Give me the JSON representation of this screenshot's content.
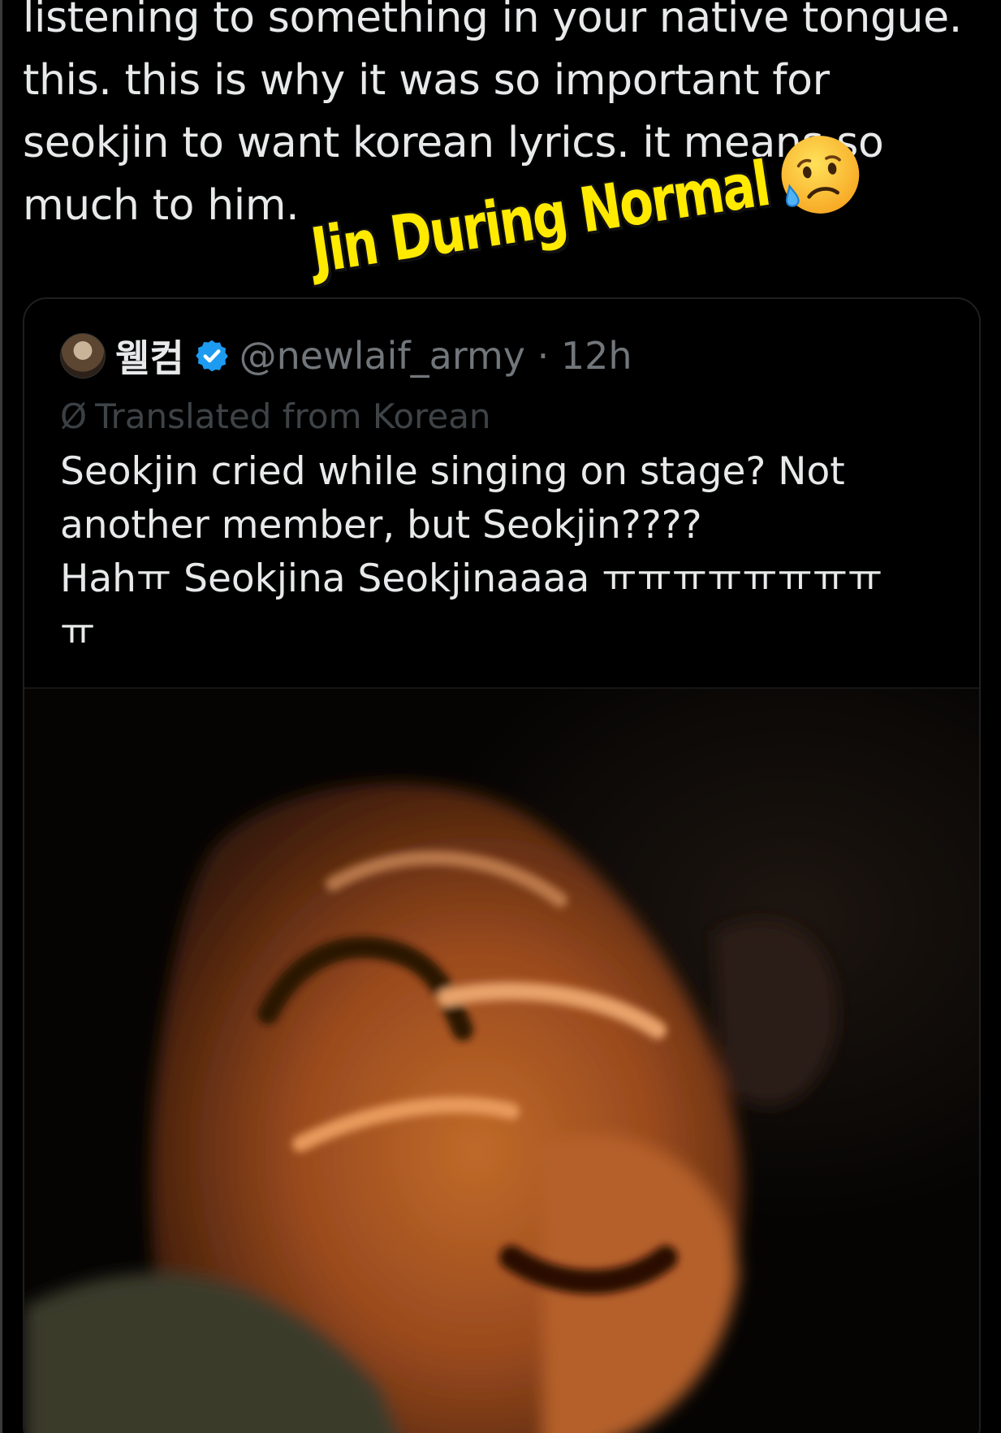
{
  "tweet": {
    "lines": [
      "listening to something in your native tongue.",
      "this. this is why it was so important for",
      "seokjin to want korean lyrics. it means so",
      "much to him."
    ]
  },
  "overlay": {
    "caption": "Jin During Normal",
    "emoji_icon": "sad-but-relieved-face-icon",
    "caption_color": "#ffea00"
  },
  "quoted_tweet": {
    "display_name": "웰컴",
    "verified_icon": "verified-badge-icon",
    "verified_color": "#1d9bf0",
    "handle_time": "@newlaif_army · 12h",
    "translated_icon": "translate-icon",
    "translated_label": "Translated from Korean",
    "body_lines": [
      "Seokjin cried while singing on stage? Not",
      "another member, but Seokjin????",
      "Hahㅠ Seokjina Seokjinaaaa ㅠㅠㅠㅠㅠㅠㅠㅠ",
      "ㅠ"
    ]
  },
  "media": {
    "type": "video-frame",
    "subject": "blurry-face-photo"
  }
}
